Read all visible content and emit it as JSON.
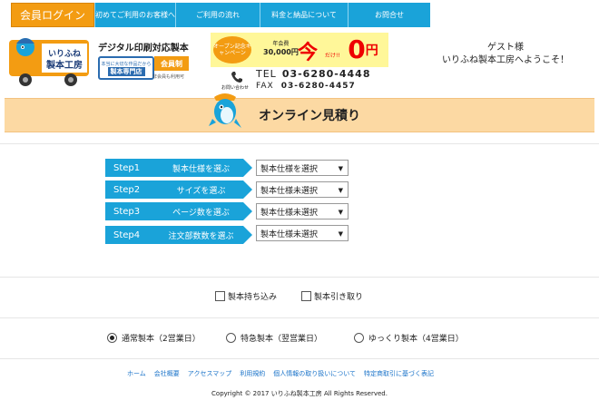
{
  "top_nav": {
    "member_login": "会員ログイン",
    "items": [
      "初めてご利用のお客様へ",
      "ご利用の流れ",
      "料金と納品について",
      "お問合せ"
    ]
  },
  "brand": {
    "logo_line1": "いりふね",
    "logo_line2": "製本工房",
    "tagline": "デジタル印刷対応製本",
    "sub_logo_small": "本当に大切な作品だから",
    "sub_logo_big": "製本専門店",
    "member_system": "会員制",
    "member_note": "非会員も利用可"
  },
  "campaign": {
    "pill": "オープン記念キャンペーン",
    "price_label": "年会費",
    "price_amount": "30,000円",
    "ima": "今",
    "dake": "だけ!!",
    "zero": "0",
    "yen": "円"
  },
  "contact": {
    "phone_label": "お問い合わせ",
    "tel_label": "TEL",
    "tel": "03-6280-4448",
    "fax_label": "FAX",
    "fax": "03-6280-4457"
  },
  "guest": {
    "line1": "ゲスト様",
    "line2": "いりふね製本工房へようこそ！"
  },
  "page_title": "オンライン見積り",
  "steps": [
    {
      "num": "Step1",
      "label": "製本仕様を選ぶ",
      "value": "製本仕様を選択"
    },
    {
      "num": "Step2",
      "label": "サイズを選ぶ",
      "value": "製本仕様未選択"
    },
    {
      "num": "Step3",
      "label": "ページ数を選ぶ",
      "value": "製本仕様未選択"
    },
    {
      "num": "Step4",
      "label": "注文部数数を選ぶ",
      "value": "製本仕様未選択"
    }
  ],
  "options": {
    "bring_in": "製本持ち込み",
    "pickup": "製本引き取り"
  },
  "speed": [
    {
      "label": "通常製本（2営業日）",
      "checked": true
    },
    {
      "label": "特急製本（翌営業日）",
      "checked": false
    },
    {
      "label": "ゆっくり製本（4営業日）",
      "checked": false
    }
  ],
  "footer": {
    "links": [
      "ホーム",
      "会社概要",
      "アクセスマップ",
      "利用規約",
      "個人情報の取り扱いについて",
      "特定商取引に基づく表記"
    ],
    "copyright": "Copyright © 2017 いりふね製本工房 All Rights Reserved."
  },
  "colors": {
    "accent": "#1aa3d9",
    "orange": "#f39c12",
    "banner": "#fcd9a3"
  }
}
